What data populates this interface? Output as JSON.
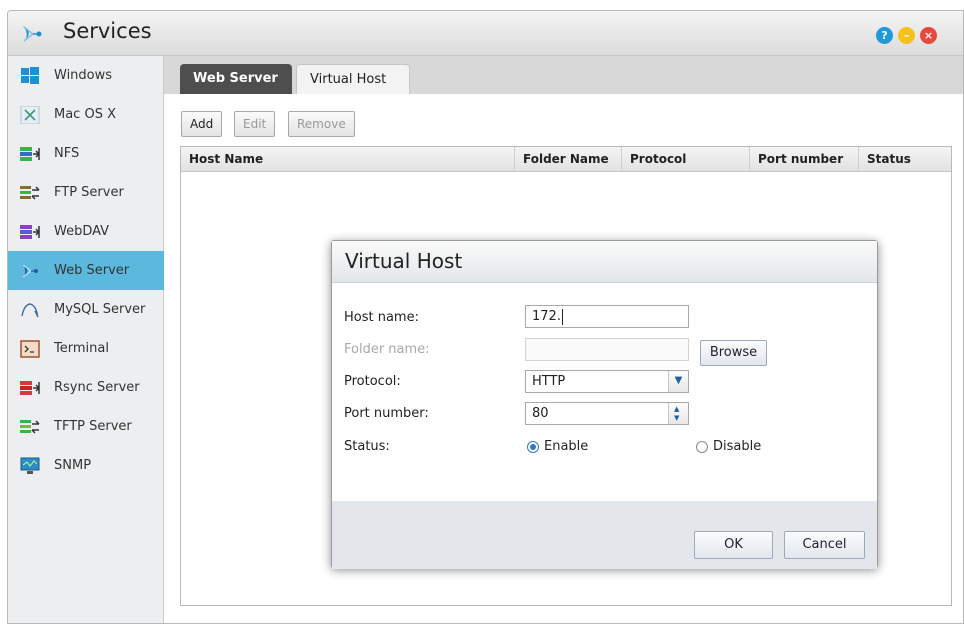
{
  "window": {
    "title": "Services",
    "app_icon": "web-server-icon",
    "controls": {
      "help_icon": "help-icon",
      "minimize_icon": "minimize-icon",
      "close_icon": "close-icon"
    }
  },
  "sidebar": {
    "items": [
      {
        "label": "Windows",
        "icon": "windows-icon"
      },
      {
        "label": "Mac OS X",
        "icon": "mac-os-x-icon"
      },
      {
        "label": "NFS",
        "icon": "nfs-icon"
      },
      {
        "label": "FTP Server",
        "icon": "ftp-server-icon"
      },
      {
        "label": "WebDAV",
        "icon": "webdav-icon"
      },
      {
        "label": "Web Server",
        "icon": "web-server-icon",
        "active": true
      },
      {
        "label": "MySQL Server",
        "icon": "mysql-server-icon"
      },
      {
        "label": "Terminal",
        "icon": "terminal-icon"
      },
      {
        "label": "Rsync Server",
        "icon": "rsync-server-icon"
      },
      {
        "label": "TFTP Server",
        "icon": "tftp-server-icon"
      },
      {
        "label": "SNMP",
        "icon": "snmp-icon"
      }
    ]
  },
  "tabs": [
    {
      "label": "Web Server",
      "active": false
    },
    {
      "label": "Virtual Host",
      "active": true
    }
  ],
  "toolbar": {
    "add_label": "Add",
    "edit_label": "Edit",
    "remove_label": "Remove"
  },
  "table": {
    "columns": [
      "Host Name",
      "Folder Name",
      "Protocol",
      "Port number",
      "Status"
    ],
    "rows": []
  },
  "dialog": {
    "title": "Virtual Host",
    "host_name_label": "Host name:",
    "host_name_value": "172.",
    "folder_name_label": "Folder name:",
    "folder_name_value": "",
    "browse_label": "Browse",
    "protocol_label": "Protocol:",
    "protocol_value": "HTTP",
    "port_label": "Port number:",
    "port_value": "80",
    "status_label": "Status:",
    "enable_label": "Enable",
    "disable_label": "Disable",
    "status_selected": "Enable",
    "ok_label": "OK",
    "cancel_label": "Cancel"
  },
  "colors": {
    "accent": "#5bb9de",
    "tab_active_bg": "#4e4e4e",
    "help": "#1f9ad6",
    "minimize": "#f5c21b",
    "close": "#e8483f"
  }
}
